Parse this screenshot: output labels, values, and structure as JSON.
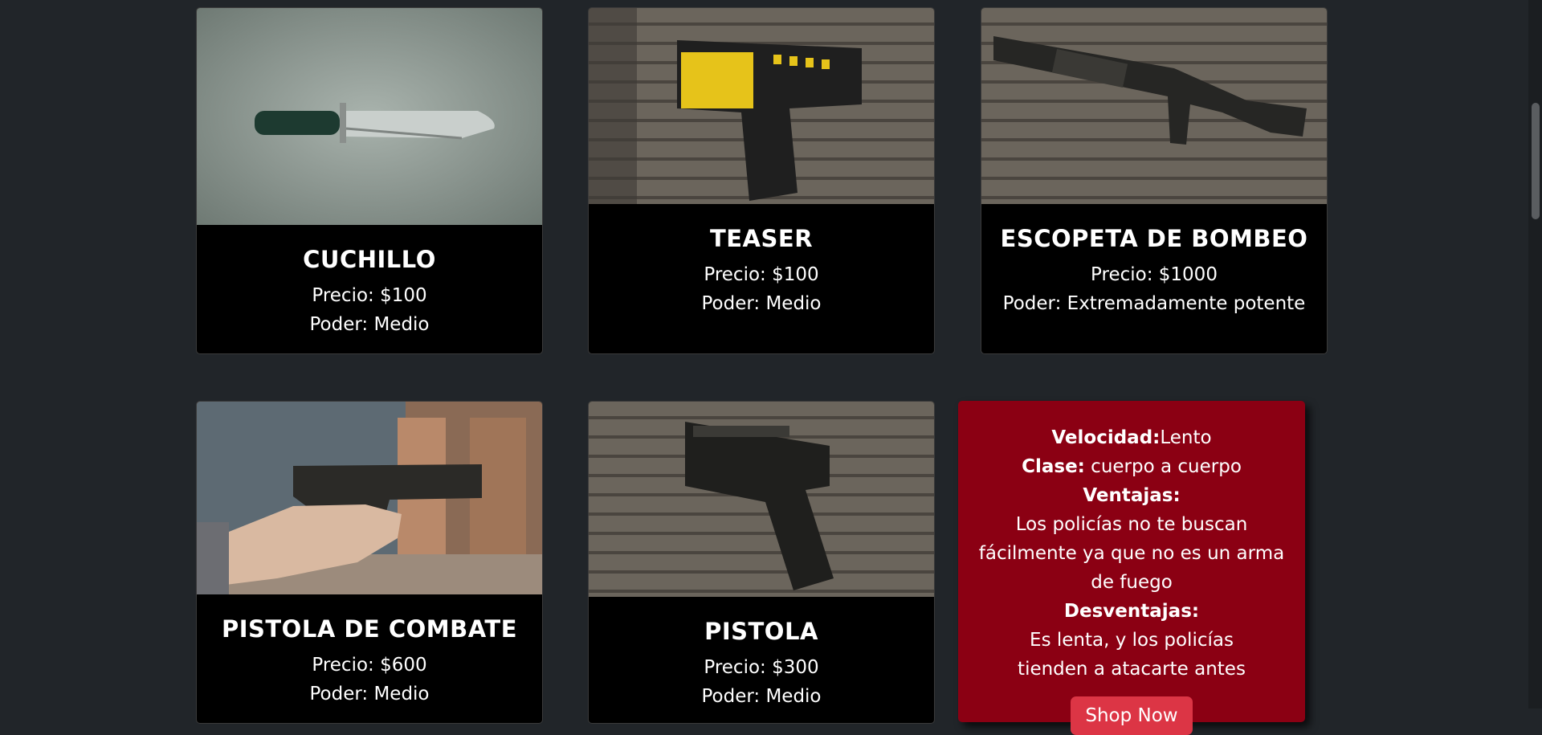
{
  "cards": [
    {
      "name": "CUCHILLO",
      "price": "Precio: $100",
      "power": "Poder: Medio",
      "image": "knife"
    },
    {
      "name": "TEASER",
      "price": "Precio: $100",
      "power": "Poder: Medio",
      "image": "taser"
    },
    {
      "name": "ESCOPETA DE BOMBEO",
      "price": "Precio: $1000",
      "power": "Poder: Extremadamente potente",
      "image": "shotgun"
    },
    {
      "name": "PISTOLA DE COMBATE",
      "price": "Precio: $600",
      "power": "Poder: Medio",
      "image": "combat-pistol"
    },
    {
      "name": "PISTOLA",
      "price": "Precio: $300",
      "power": "Poder: Medio",
      "image": "pistol"
    }
  ],
  "info": {
    "speed_label": "Velocidad:",
    "speed_value": "Lento",
    "class_label": "Clase:",
    "class_value": " cuerpo a cuerpo",
    "pros_label": "Ventajas:",
    "pros_text": "Los policías no te buscan fácilmente ya que no es un arma de fuego",
    "cons_label": "Desventajas:",
    "cons_text": "Es lenta, y los policías tienden a atacarte antes",
    "button": "Shop Now"
  },
  "colors": {
    "info_bg": "#8b0013",
    "button": "#dc3545",
    "page_bg": "#212529"
  }
}
